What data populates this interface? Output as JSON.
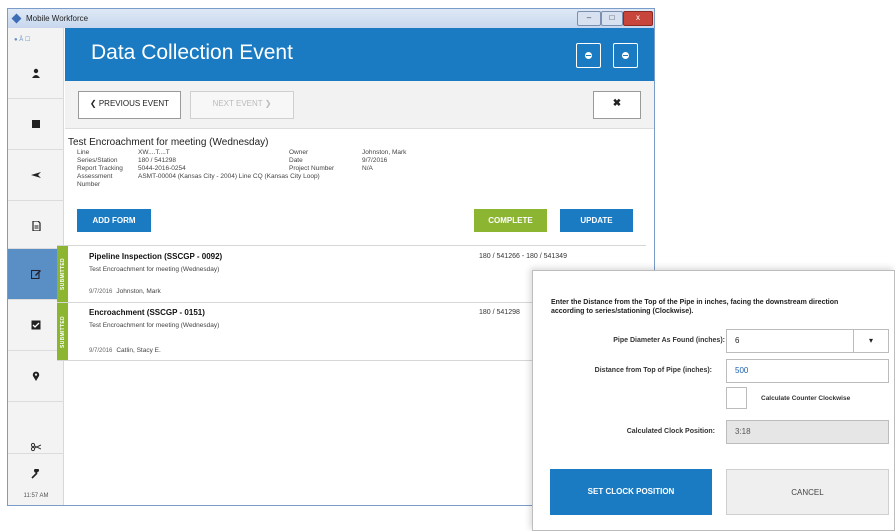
{
  "window": {
    "title": "Mobile Workforce",
    "minimize": "–",
    "maximize": "□",
    "close": "x"
  },
  "sidebar": {
    "top_glyphs": "● Å ☐",
    "time": "11:57 AM",
    "active_color": "#5a8fc6",
    "icons": [
      "user-icon",
      "square-icon",
      "plane-icon",
      "document-icon",
      "edit-icon",
      "checkbox-icon",
      "location-pin-icon",
      "scissors-icon",
      "wrench-icon"
    ]
  },
  "header": {
    "title": "Data Collection Event",
    "color": "#1a7bc3"
  },
  "nav": {
    "previous": "❮ PREVIOUS EVENT",
    "next": "NEXT EVENT ❯",
    "close": "✖"
  },
  "event": {
    "title": "Test Encroachment for meeting (Wednesday)",
    "left_labels": [
      "Line",
      "Series/Station",
      "Report Tracking",
      "Assessment Number"
    ],
    "left_values": [
      "XW....T....T",
      "180 / 541298",
      "5044-2016-0254",
      "ASMT-00004 (Kansas City - 2004) Line CQ (Kansas City Loop)"
    ],
    "right_labels": [
      "Owner",
      "Date",
      "Project Number"
    ],
    "right_values": [
      "Johnston, Mark",
      "9/7/2016",
      "N/A"
    ]
  },
  "actions": {
    "add_form": "ADD FORM",
    "complete": "COMPLETE",
    "update": "UPDATE",
    "blue": "#1a7bc3",
    "green": "#8cb532"
  },
  "forms": [
    {
      "status": "SUBMITTED",
      "title": "Pipeline Inspection  (SSCGP - 0092)",
      "subtitle": "Test Encroachment for meeting (Wednesday)",
      "date": "9/7/2016",
      "person": "Johnston, Mark",
      "range": "180 / 541266 - 180 / 541349"
    },
    {
      "status": "SUBMITTED",
      "title": "Encroachment  (SSCGP - 0151)",
      "subtitle": "Test Encroachment for meeting (Wednesday)",
      "date": "9/7/2016",
      "person": "Catlin, Stacy E.",
      "range": "180 / 541298"
    }
  ],
  "modal": {
    "instruction": "Enter the Distance from the Top of the Pipe in inches, facing the downstream direction according to series/stationing (Clockwise).",
    "diameter_label": "Pipe Diameter As Found (inches):",
    "diameter_value": "6",
    "diameter_caret": "▾",
    "distance_label": "Distance from Top of Pipe (inches):",
    "distance_value": "500",
    "ccw_label": "Calculate Counter Clockwise",
    "clock_label": "Calculated Clock Position:",
    "clock_value": "3:18",
    "set_button": "SET CLOCK POSITION",
    "cancel_button": "CANCEL"
  }
}
